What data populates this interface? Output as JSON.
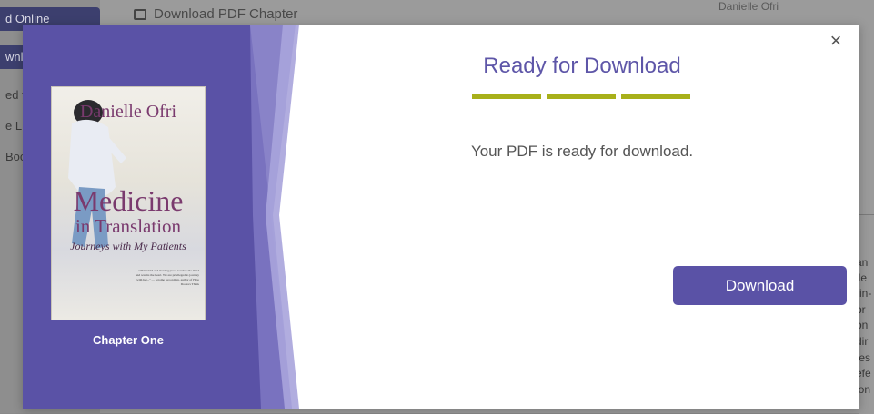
{
  "background": {
    "nav_buttons": [
      "d Online",
      "wnlo"
    ],
    "side_items": [
      "ed t",
      "e L",
      "Boc"
    ],
    "top_link": "Download PDF Chapter",
    "top_right": "Danielle Ofri",
    "right_fragments": [
      "an",
      "lle",
      "-in-",
      "pr",
      "on",
      "dir",
      "tes",
      "efe",
      "ion"
    ]
  },
  "modal": {
    "title": "Ready for Download",
    "message": "Your PDF is ready for download.",
    "download_label": "Download",
    "close_label": "×",
    "chapter_label": "Chapter One",
    "cover": {
      "author": "Danielle Ofri",
      "title_line1": "Medicine",
      "title_line2": "in Translation",
      "subtitle": "Journeys with My Patients",
      "blurb": "\"This vivid and moving prose touches the mind and warms the heart. We are privileged to journey with her...\" — Jerome Groopman, author of How Doctors Think"
    }
  },
  "colors": {
    "modal_left_panel": "#5a52a6",
    "accent_bar": "#a8b01a",
    "title_text": "#5e56a8",
    "button_bg": "#5a52a6"
  }
}
